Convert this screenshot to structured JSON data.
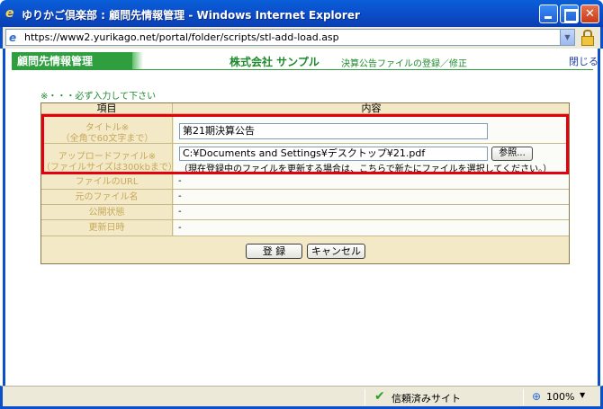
{
  "window": {
    "title": "ゆりかご倶楽部 : 顧問先情報管理 - Windows Internet Explorer"
  },
  "addressbar": {
    "url": "https://www2.yurikago.net/portal/folder/scripts/stl-add-load.asp"
  },
  "appbar": {
    "section_label": "顧問先情報管理",
    "company": "株式会社 サンプル",
    "page_title": "決算公告ファイルの登録／修正",
    "close_link": "閉じる"
  },
  "form": {
    "required_note": "※・・・必ず入力して下さい",
    "header": {
      "item": "項目",
      "content": "内容"
    },
    "title_row": {
      "label_line1": "タイトル※",
      "label_line2": "（全角で60文字まで）",
      "value": "第21期決算公告"
    },
    "upload_row": {
      "label_line1": "アップロードファイル※",
      "label_line2": "（ファイルサイズは300kbまで）",
      "file_path": "C:¥Documents and Settings¥デスクトップ¥21.pdf",
      "browse_label": "参照...",
      "note": "（現在登録中のファイルを更新する場合は、こちらで新たにファイルを選択してください。）"
    },
    "info_rows": [
      {
        "label": "ファイルのURL",
        "value": "-"
      },
      {
        "label": "元のファイル名",
        "value": "-"
      },
      {
        "label": "公開状態",
        "value": "-"
      },
      {
        "label": "更新日時",
        "value": "-"
      }
    ],
    "register_label": "登 録",
    "cancel_label": "キャンセル"
  },
  "statusbar": {
    "zone": "信頼済みサイト",
    "zoom": "100%"
  },
  "colors": {
    "accent_green": "#2e9e3e",
    "highlight_red": "#e3000f",
    "table_bg": "#f3e9c6",
    "label_text": "#c7a85a"
  }
}
